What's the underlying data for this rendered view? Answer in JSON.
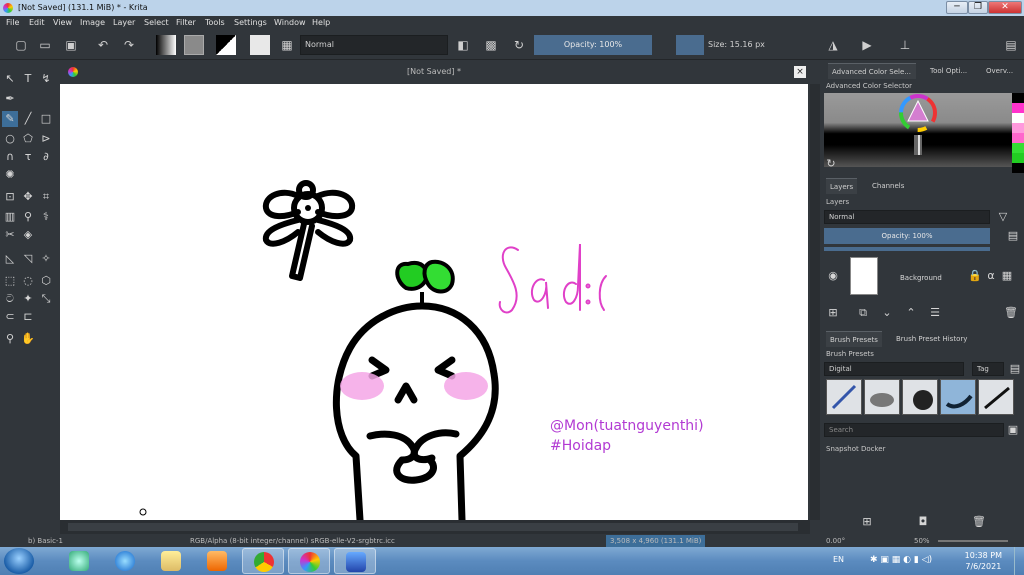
{
  "window": {
    "title": "[Not Saved]  (131.1 MiB)  * - Krita",
    "min": "─",
    "max": "❐",
    "close": "✕"
  },
  "menu": [
    "File",
    "Edit",
    "View",
    "Image",
    "Layer",
    "Select",
    "Filter",
    "Tools",
    "Settings",
    "Window",
    "Help"
  ],
  "toolbar": {
    "blend_mode": "Normal",
    "opacity": "Opacity: 100%",
    "size": "Size: 15.16 px"
  },
  "document": {
    "tab_title": "[Not Saved]  *",
    "close": "×"
  },
  "canvas": {
    "scribble_text": "Sad :(",
    "credit_line1": "@Mon(tuatnguyenthi)",
    "credit_line2": "#Hoidap"
  },
  "dockers": {
    "top_tabs": [
      "Advanced Color Sele...",
      "Tool Opti...",
      "Overv..."
    ],
    "color_selector_title": "Advanced Color Selector",
    "layer_tabs": [
      "Layers",
      "Channels"
    ],
    "layers_title": "Layers",
    "layer_blend": "Normal",
    "layer_opacity": "Opacity:  100%",
    "layer_name": "Background",
    "preset_tabs": [
      "Brush Presets",
      "Brush Preset History"
    ],
    "presets_title": "Brush Presets",
    "preset_tag": "Digital",
    "tag_label": "Tag",
    "search_placeholder": "Search",
    "snapshot_title": "Snapshot Docker",
    "swatch_colors": [
      "#ffffff",
      "#ff33cc",
      "#ffffff",
      "#ff99dd",
      "#ff66cc",
      "#33dd33",
      "#22cc22",
      "#000000"
    ]
  },
  "statusbar": {
    "brush": "b) Basic-1",
    "color_model": "RGB/Alpha (8-bit integer/channel)  sRGB-elle-V2-srgbtrc.icc",
    "dimensions": "3,508 x 4,960 (131.1 MiB)",
    "rotation": "0.00°",
    "zoom": "50%"
  },
  "taskbar": {
    "lang": "EN",
    "time": "10:38 PM",
    "date": "7/6/2021"
  },
  "colors": {
    "accent": "#3d6e99",
    "slider": "#4a6c8f",
    "credit": "#b23ad3",
    "scribble": "#e040c8",
    "sprout": "#22cc22",
    "blush": "#f5a6e6"
  }
}
